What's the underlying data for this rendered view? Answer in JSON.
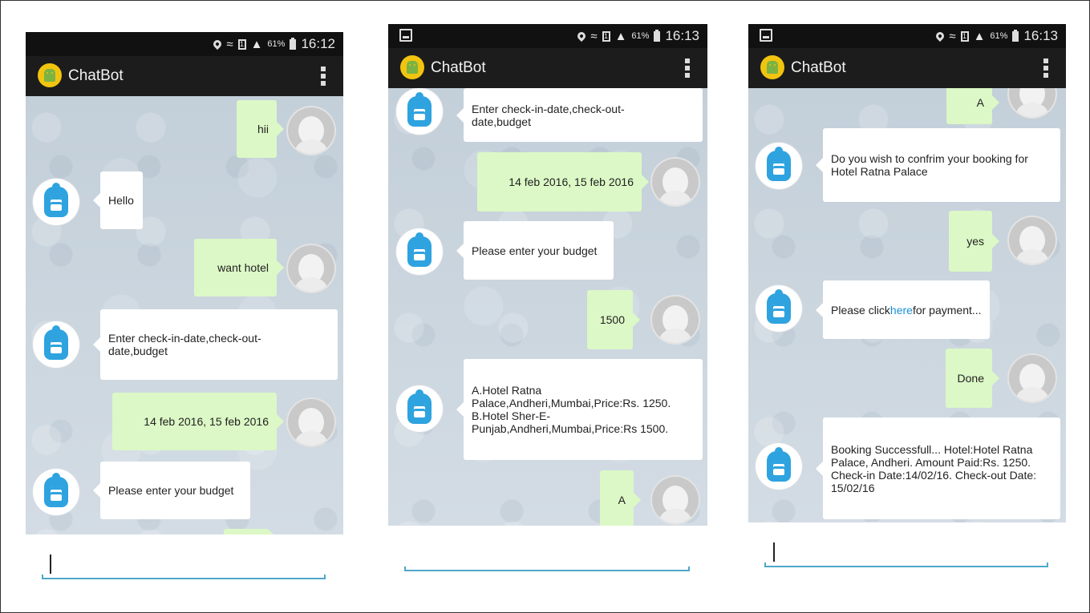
{
  "status_bar": {
    "battery": "61%",
    "time_1": "16:12",
    "time_2": "16:13",
    "time_3": "16:13"
  },
  "app": {
    "title": "ChatBot"
  },
  "colors": {
    "user_bubble": "#dcf8c6",
    "bot_bubble": "#ffffff",
    "bot_avatar": "#2ea3df",
    "input_underline": "#4ea7c9"
  },
  "phone1": {
    "messages": [
      {
        "from": "user",
        "text": "hii"
      },
      {
        "from": "bot",
        "text": "Hello"
      },
      {
        "from": "user",
        "text": "want hotel"
      },
      {
        "from": "bot",
        "text": "Enter check-in-date,check-out-date,budget"
      },
      {
        "from": "user",
        "text": "14 feb 2016, 15 feb 2016"
      },
      {
        "from": "bot",
        "text": "Please enter your budget"
      }
    ]
  },
  "phone2": {
    "messages": [
      {
        "from": "bot",
        "text": "Enter check-in-date,check-out-date,budget"
      },
      {
        "from": "user",
        "text": "14 feb 2016, 15 feb 2016"
      },
      {
        "from": "bot",
        "text": "Please enter your budget"
      },
      {
        "from": "user",
        "text": "1500"
      },
      {
        "from": "bot",
        "text": "A.Hotel Ratna Palace,Andheri,Mumbai,Price:Rs. 1250. B.Hotel Sher-E-Punjab,Andheri,Mumbai,Price:Rs 1500."
      },
      {
        "from": "user",
        "text": "A"
      }
    ]
  },
  "phone3": {
    "messages": [
      {
        "from": "user",
        "text": "A"
      },
      {
        "from": "bot",
        "text": "Do you wish to confrim your booking for Hotel Ratna Palace"
      },
      {
        "from": "user",
        "text": "yes"
      },
      {
        "from": "bot",
        "text_before": "Please click",
        "link": "here",
        "text_after": "for payment..."
      },
      {
        "from": "user",
        "text": "Done"
      },
      {
        "from": "bot",
        "text": "Booking Successfull... Hotel:Hotel Ratna Palace, Andheri. Amount Paid:Rs. 1250. Check-in Date:14/02/16. Check-out Date: 15/02/16"
      }
    ]
  }
}
